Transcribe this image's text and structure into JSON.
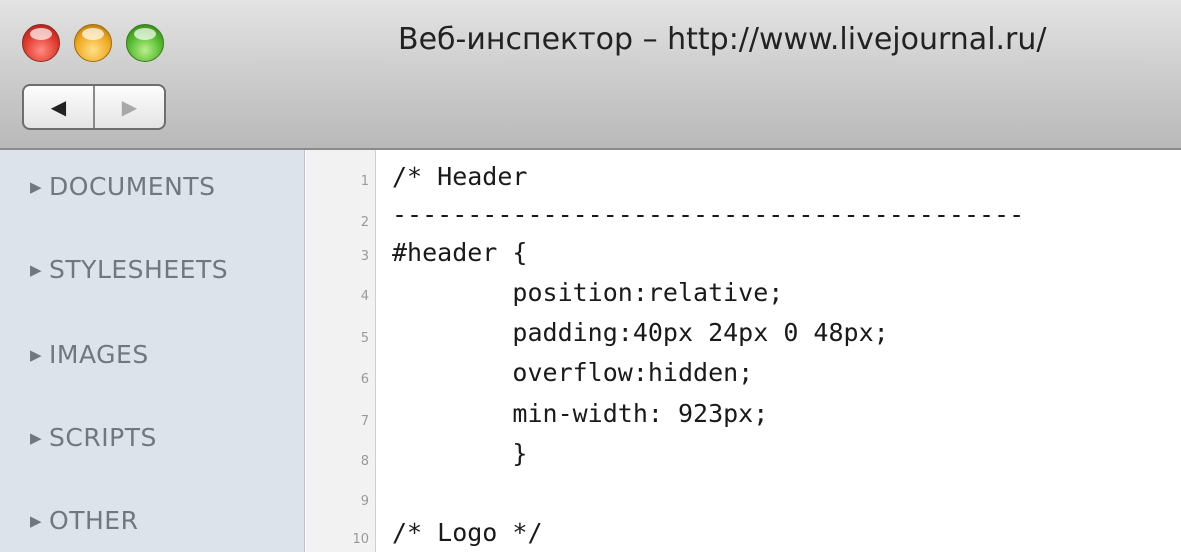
{
  "window": {
    "title": "Веб-инспектор – http://www.livejournal.ru/"
  },
  "nav": {
    "back_icon": "◀",
    "forward_icon": "▶"
  },
  "sidebar": {
    "arrow": "▶",
    "items": [
      {
        "label": "DOCUMENTS"
      },
      {
        "label": "STYLESHEETS"
      },
      {
        "label": "IMAGES"
      },
      {
        "label": "SCRIPTS"
      },
      {
        "label": "OTHER"
      }
    ]
  },
  "editor": {
    "line_numbers": [
      "1",
      "2",
      "3",
      "4",
      "5",
      "6",
      "7",
      "8",
      "9",
      "10"
    ],
    "lines": [
      "/* Header",
      "------------------------------------------",
      "#header {",
      "        position:relative;",
      "        padding:40px 24px 0 48px;",
      "        overflow:hidden;",
      "        min-width: 923px;",
      "        }",
      "",
      "/* Logo */"
    ]
  },
  "colors": {
    "sidebar_bg": "#dde3ea",
    "sidebar_text": "#6f7780",
    "close": "#e0382c",
    "minimize": "#f0a91e",
    "maximize": "#52b82c"
  }
}
